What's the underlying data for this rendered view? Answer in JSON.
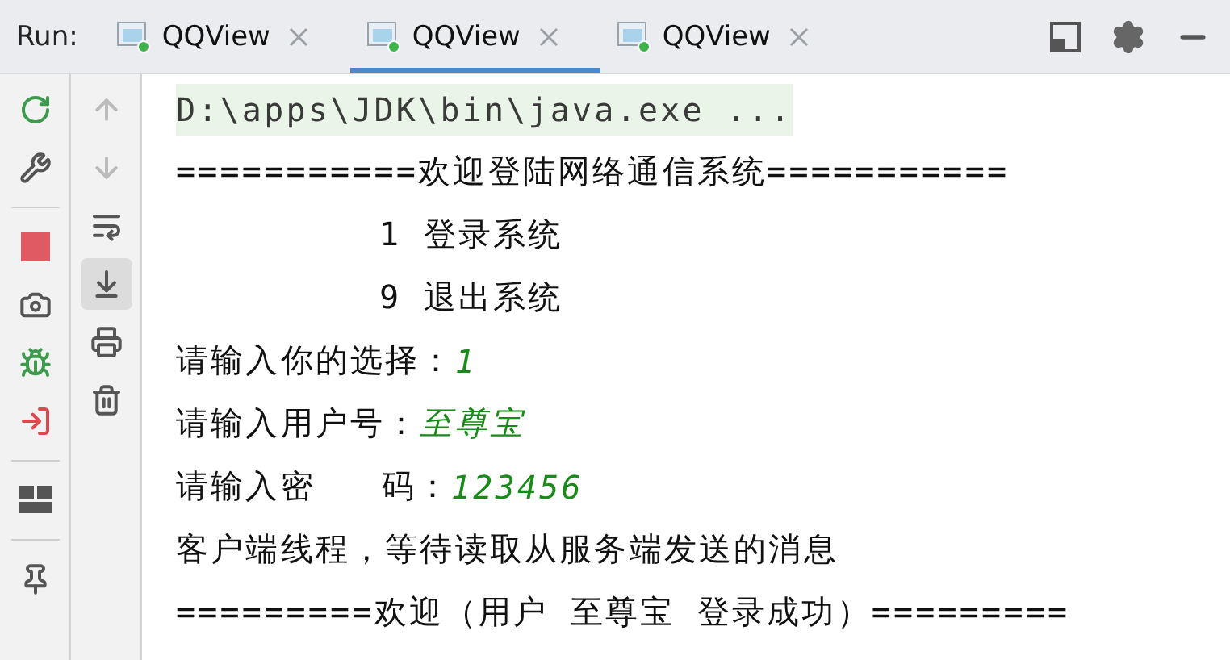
{
  "run_bar": {
    "title": "Run:"
  },
  "tabs": [
    {
      "label": "QQView",
      "selected": false
    },
    {
      "label": "QQView",
      "selected": true
    },
    {
      "label": "QQView",
      "selected": false
    }
  ],
  "console_toolbar": {
    "scroll_to_end_on": true
  },
  "console": {
    "lines": [
      {
        "kind": "command",
        "segments": [
          {
            "text": "D:\\apps\\JDK\\bin\\java.exe ..."
          }
        ]
      },
      {
        "kind": "output",
        "segments": [
          {
            "kind": "output",
            "text": "===========欢迎登陆网络通信系统==========="
          }
        ]
      },
      {
        "kind": "menu",
        "segments": [
          {
            "kind": "output",
            "text": "1 登录系统"
          }
        ]
      },
      {
        "kind": "menu",
        "segments": [
          {
            "kind": "output",
            "text": "9 退出系统"
          }
        ]
      },
      {
        "kind": "output",
        "segments": [
          {
            "kind": "output",
            "text": "请输入你的选择："
          },
          {
            "kind": "input",
            "text": "1"
          }
        ]
      },
      {
        "kind": "output",
        "segments": [
          {
            "kind": "output",
            "text": "请输入用户号："
          },
          {
            "kind": "input",
            "text": "至尊宝"
          }
        ]
      },
      {
        "kind": "output",
        "segments": [
          {
            "kind": "output",
            "text": "请输入密   码："
          },
          {
            "kind": "input",
            "text": "123456"
          }
        ]
      },
      {
        "kind": "output",
        "segments": [
          {
            "kind": "output",
            "text": "客户端线程，等待读取从服务端发送的消息"
          }
        ]
      },
      {
        "kind": "output",
        "segments": [
          {
            "kind": "output",
            "text": "=========欢迎（用户 至尊宝 登录成功）========="
          }
        ]
      }
    ]
  }
}
